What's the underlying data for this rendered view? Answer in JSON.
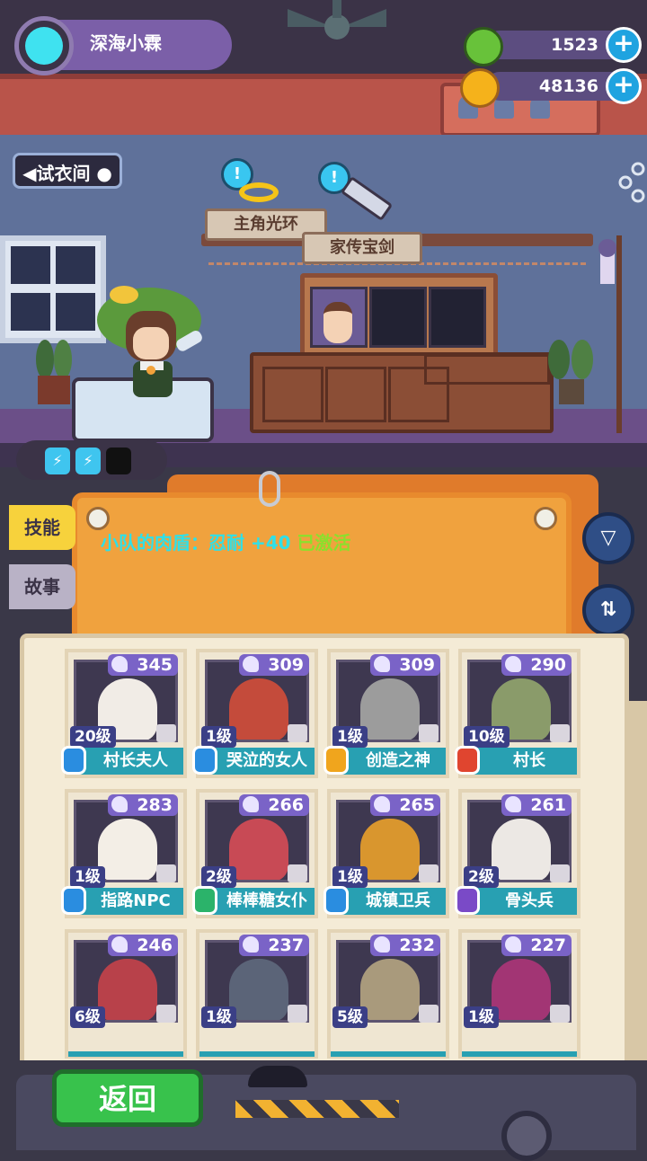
{
  "player": {
    "name": "深海小霖"
  },
  "currency": [
    {
      "name": "gem",
      "value": "1523",
      "color": "#68c23a"
    },
    {
      "name": "coin",
      "value": "48136",
      "color": "#f5b21b"
    }
  ],
  "room": {
    "fitting_room_label": "◀试衣间 ●",
    "shelf_items": [
      {
        "label": "主角光环"
      },
      {
        "label": "家传宝剑"
      }
    ],
    "bubble_glyph": "!"
  },
  "energy": {
    "slots": [
      "⚡",
      "⚡"
    ]
  },
  "skill": {
    "text": "小队的肉盾：忍耐 +40",
    "status": "已激活"
  },
  "side_tabs": [
    {
      "label": "技能",
      "active": true
    },
    {
      "label": "故事",
      "active": false
    }
  ],
  "buttons": {
    "back": "返回",
    "filter_icon": "▽",
    "sort_icon": "⇅"
  },
  "characters": [
    {
      "power": "345",
      "level": "20级",
      "name": "村长夫人",
      "badge": "#2a8de0",
      "face": "#f1ece6"
    },
    {
      "power": "309",
      "level": "1级",
      "name": "哭泣的女人",
      "badge": "#2a8de0",
      "face": "#c44b3b"
    },
    {
      "power": "309",
      "level": "1级",
      "name": "创造之神",
      "badge": "#f0a51d",
      "face": "#9c9c9c"
    },
    {
      "power": "290",
      "level": "10级",
      "name": "村长",
      "badge": "#e0452f",
      "face": "#8a9b6a"
    },
    {
      "power": "283",
      "level": "1级",
      "name": "指路NPC",
      "badge": "#2a8de0",
      "face": "#f3eee6"
    },
    {
      "power": "266",
      "level": "2级",
      "name": "棒棒糖女仆",
      "badge": "#2bb36a",
      "face": "#c84a55"
    },
    {
      "power": "265",
      "level": "1级",
      "name": "城镇卫兵",
      "badge": "#2a8de0",
      "face": "#d9962e"
    },
    {
      "power": "261",
      "level": "2级",
      "name": "骨头兵",
      "badge": "#7a4ac7",
      "face": "#ece8e4"
    },
    {
      "power": "246",
      "level": "6级",
      "name": "",
      "badge": "",
      "face": "#b8414a"
    },
    {
      "power": "237",
      "level": "1级",
      "name": "",
      "badge": "",
      "face": "#5b6478"
    },
    {
      "power": "232",
      "level": "5级",
      "name": "",
      "badge": "",
      "face": "#a99a7c"
    },
    {
      "power": "227",
      "level": "1级",
      "name": "",
      "badge": "",
      "face": "#a23574"
    }
  ]
}
